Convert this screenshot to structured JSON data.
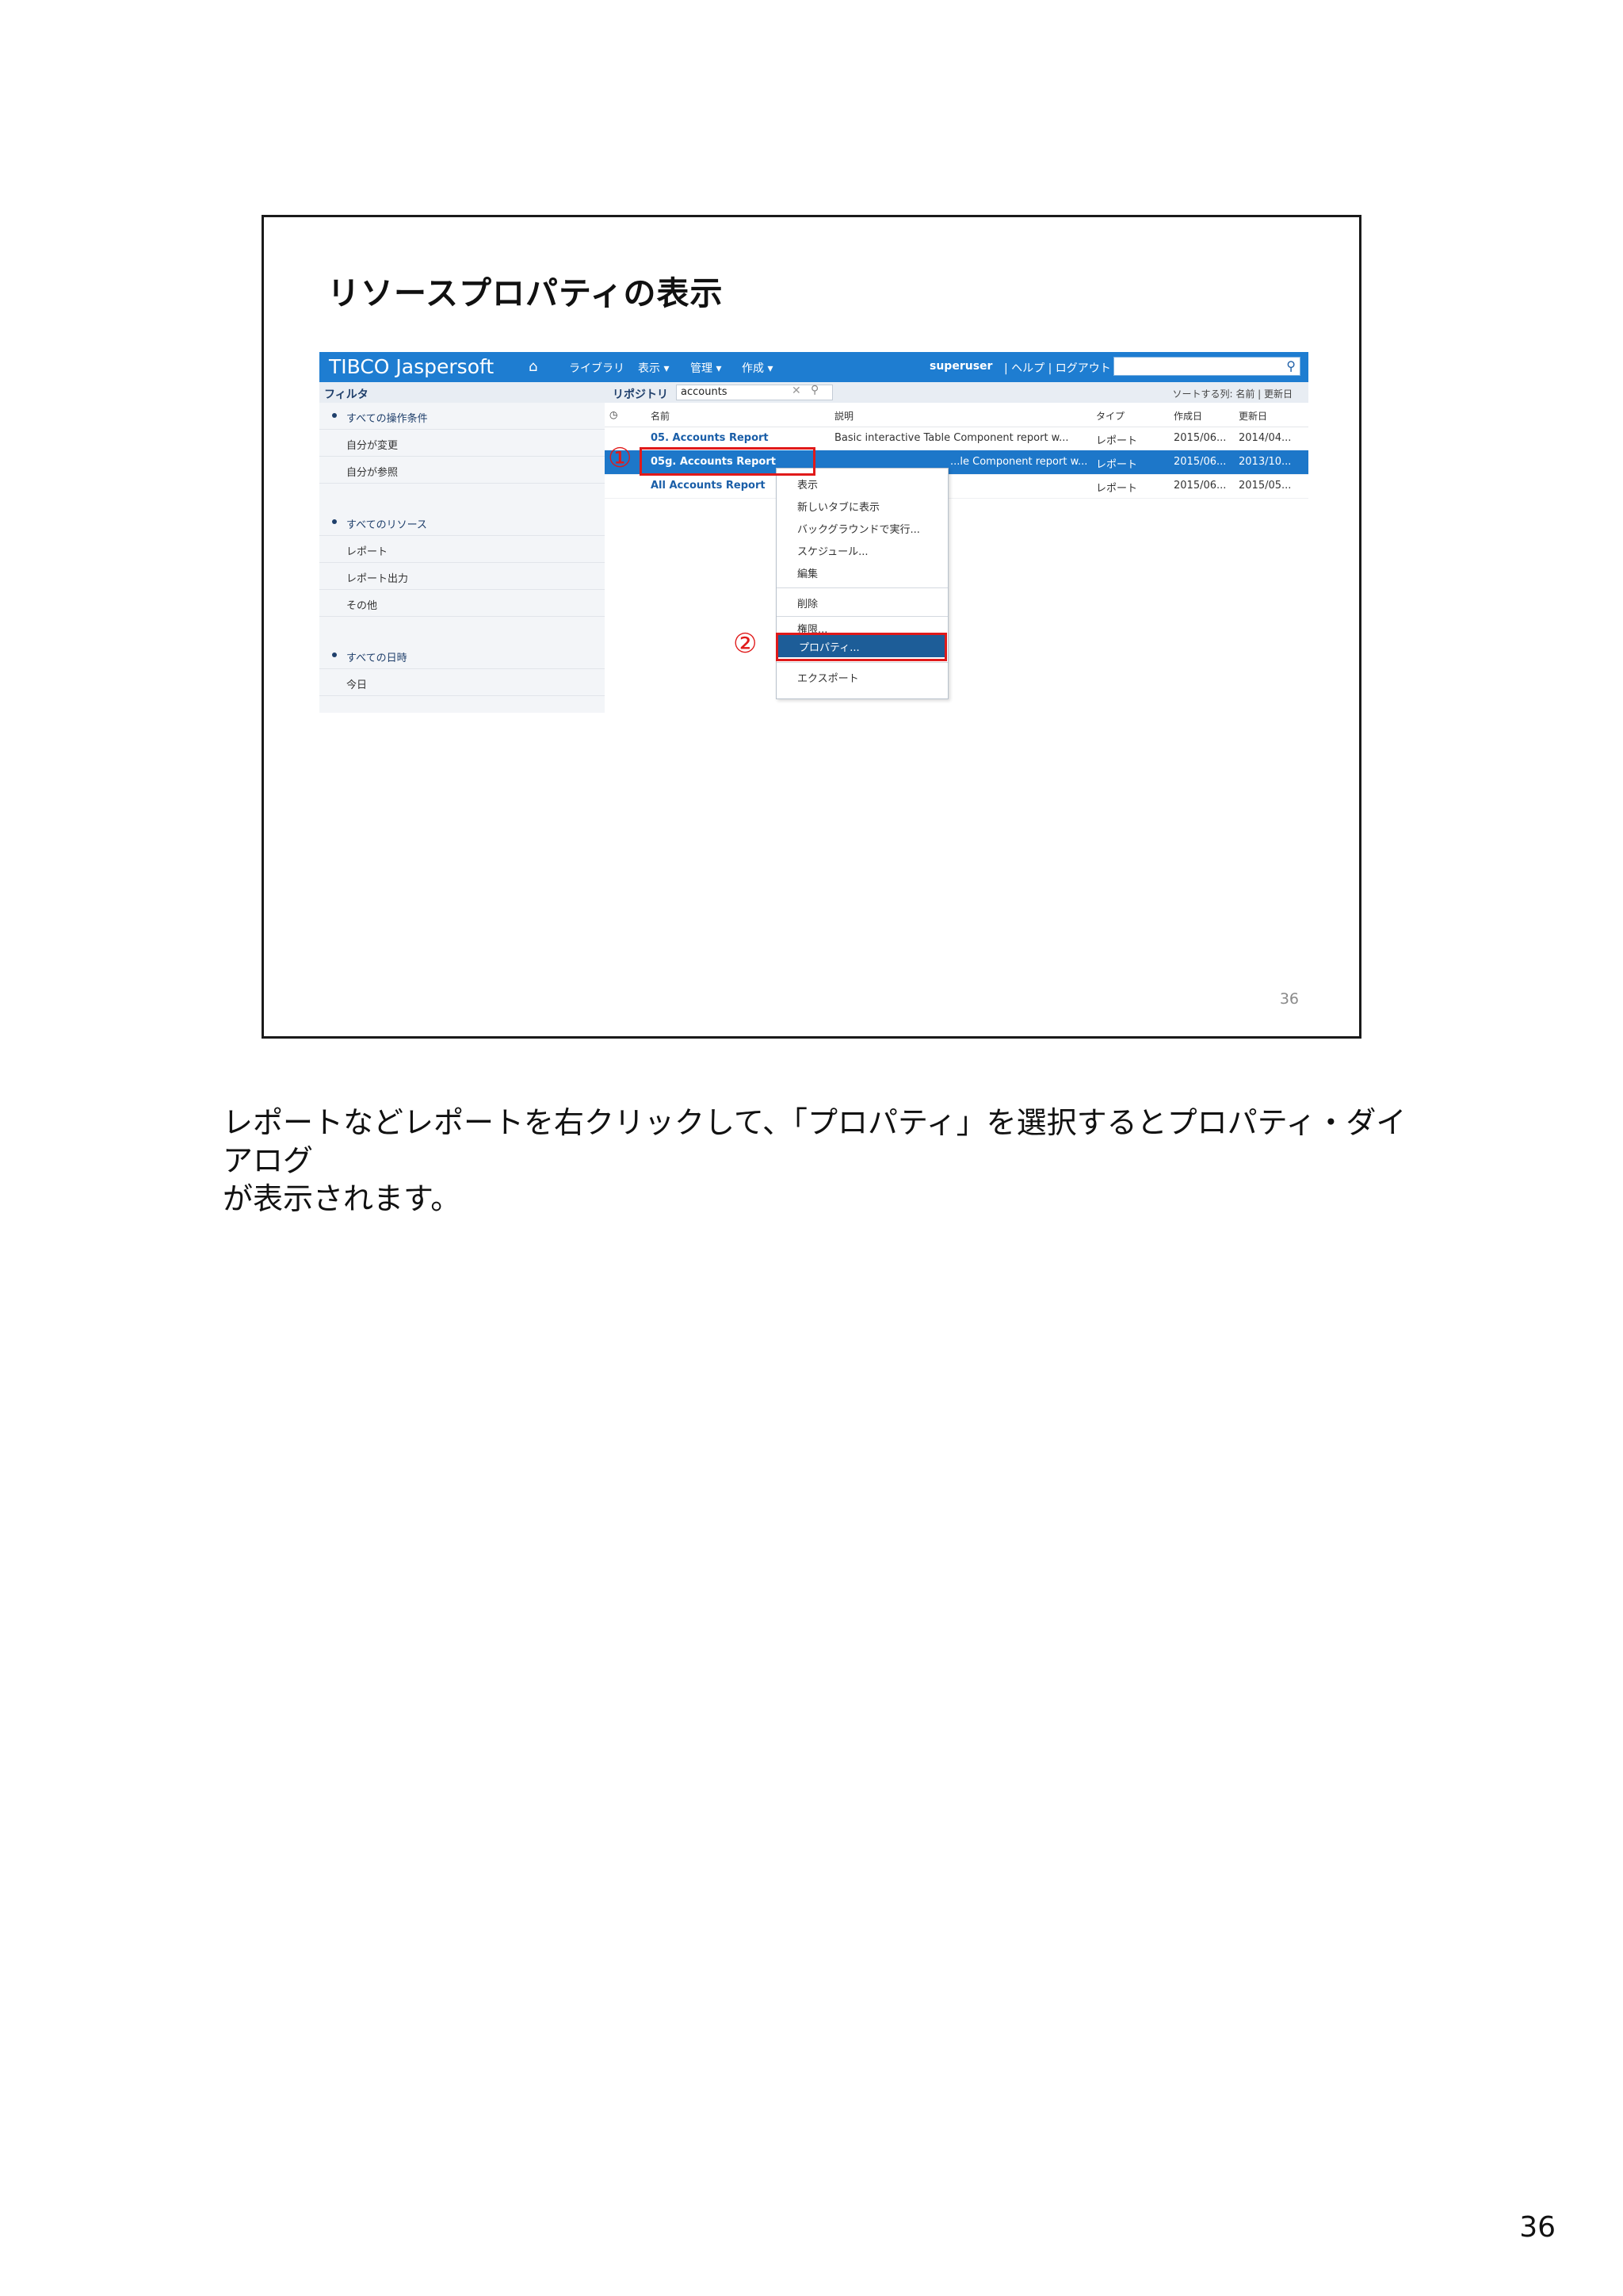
{
  "slide": {
    "title": "リソースプロパティの表示",
    "slide_number": "36"
  },
  "app": {
    "brand": "TIBCO Jaspersoft",
    "nav": [
      "ライブラリ",
      "表示 ▾",
      "管理 ▾",
      "作成 ▾"
    ],
    "user": "superuser",
    "help_links": "|  ヘルプ  |  ログアウト"
  },
  "filter": {
    "label": "フィルタ",
    "groups": [
      {
        "head": "すべての操作条件",
        "items": [
          "自分が変更",
          "自分が参照"
        ]
      },
      {
        "head": "すべてのリソース",
        "items": [
          "レポート",
          "レポート出力",
          "その他"
        ]
      },
      {
        "head": "すべての日時",
        "items": [
          "今日"
        ]
      }
    ]
  },
  "repository": {
    "label": "リポジトリ",
    "search_value": "accounts",
    "sort_label": "ソートする列:  名前  |  更新日",
    "columns": [
      "名前",
      "説明",
      "タイプ",
      "作成日",
      "更新日"
    ],
    "rows": [
      {
        "name": "05. Accounts Report",
        "desc": "Basic interactive Table Component report w...",
        "type": "レポート",
        "created": "2015/06...",
        "updated": "2014/04..."
      },
      {
        "name": "05g. Accounts Report",
        "desc": "...le Component report w...",
        "type": "レポート",
        "created": "2015/06...",
        "updated": "2013/10..."
      },
      {
        "name": "All Accounts Report",
        "desc": "",
        "type": "レポート",
        "created": "2015/06...",
        "updated": "2015/05..."
      }
    ]
  },
  "context_menu": {
    "items": [
      "表示",
      "新しいタブに表示",
      "バックグラウンドで実行...",
      "スケジュール...",
      "編集",
      "削除",
      "権限...",
      "プロパティ...",
      "エクスポート"
    ],
    "highlighted": "プロパティ..."
  },
  "markers": {
    "one": "①",
    "two": "②"
  },
  "caption": {
    "line1": "レポートなどレポートを右クリックして、「プロパティ」を選択するとプロパティ・ダイアログ",
    "line2": "が表示されます。"
  },
  "page_number": "36"
}
